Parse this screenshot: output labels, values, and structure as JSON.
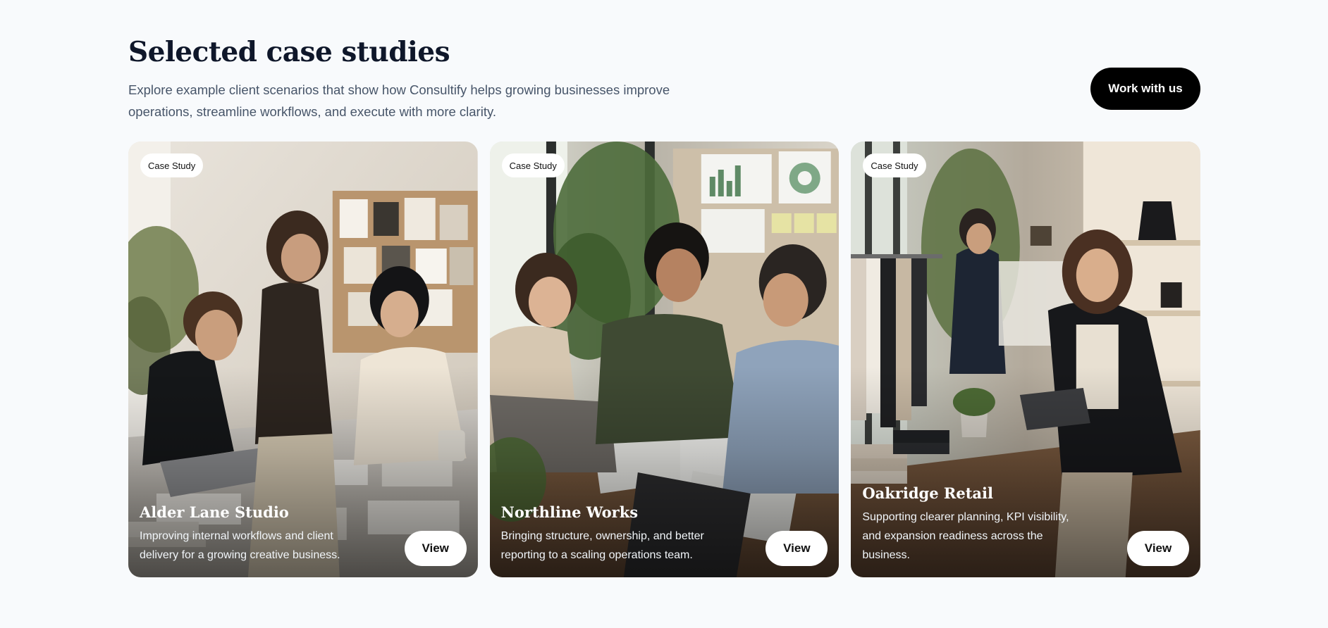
{
  "header": {
    "title": "Selected case studies",
    "subtitle": "Explore example client scenarios that show how Consultify helps growing businesses improve operations, streamline workflows, and execute with more clarity.",
    "cta_label": "Work with us"
  },
  "cards": [
    {
      "badge": "Case Study",
      "title": "Alder Lane Studio",
      "description": "Improving internal workflows and client delivery for a growing creative business.",
      "button": "View"
    },
    {
      "badge": "Case Study",
      "title": "Northline Works",
      "description": "Bringing structure, ownership, and better reporting to a scaling operations team.",
      "button": "View"
    },
    {
      "badge": "Case Study",
      "title": "Oakridge Retail",
      "description": "Supporting clearer planning, KPI visibility, and expansion readiness across the business.",
      "button": "View"
    }
  ],
  "colors": {
    "background": "#f8fafc",
    "heading": "#0f172a",
    "body_text": "#475569",
    "cta_background": "#000000",
    "cta_text": "#ffffff"
  }
}
